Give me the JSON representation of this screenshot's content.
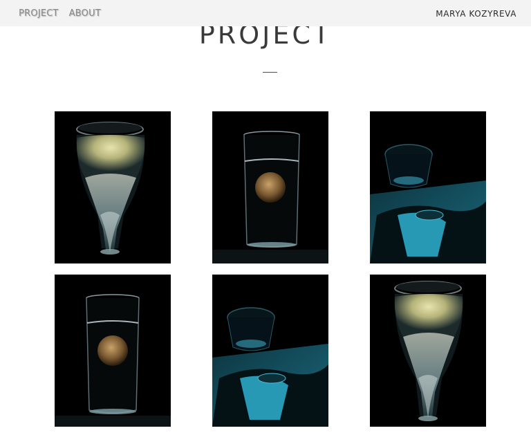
{
  "nav": {
    "project_label": "PROJECT",
    "about_label": "ABOUT"
  },
  "brand": {
    "name": "MARYA KOZYREVA"
  },
  "page": {
    "title": "PROJECT"
  },
  "gallery": {
    "items": [
      {
        "subject": "tilted-jar-with-yellow-swirl"
      },
      {
        "subject": "glass-with-sinking-fruit"
      },
      {
        "subject": "glass-with-blue-reflection"
      },
      {
        "subject": "glass-with-sinking-fruit"
      },
      {
        "subject": "glass-with-blue-reflection"
      },
      {
        "subject": "tilted-jar-with-yellow-swirl"
      }
    ]
  },
  "colors": {
    "topbar_bg": "#f3f3f3",
    "nav_text": "#8a8a8a",
    "brand_text": "#2a2a2a",
    "title_text": "#3a3a3a",
    "photo_bg": "#000000",
    "accent_teal": "#1fa0bd",
    "accent_yellow": "#d8d49a"
  }
}
